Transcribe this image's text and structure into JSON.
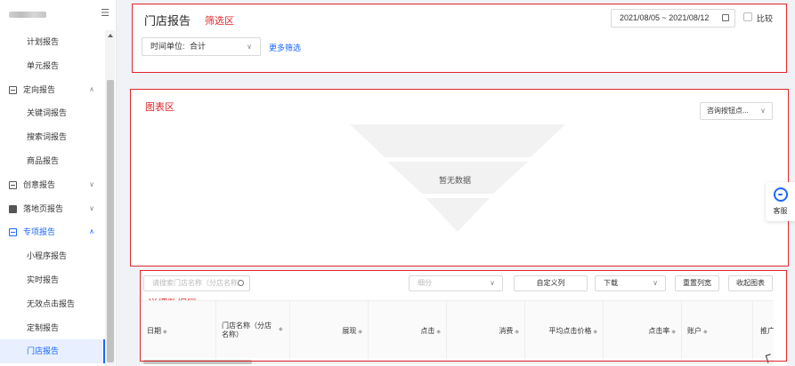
{
  "sidebar": {
    "collapse_icon": "menu-fold-icon",
    "items": [
      {
        "label": "计划报告",
        "type": "sub"
      },
      {
        "label": "单元报告",
        "type": "sub"
      },
      {
        "label": "定向报告",
        "type": "group",
        "icon": "document-icon",
        "expanded": true
      },
      {
        "label": "关键词报告",
        "type": "sub"
      },
      {
        "label": "搜索词报告",
        "type": "sub"
      },
      {
        "label": "商品报告",
        "type": "sub"
      },
      {
        "label": "创意报告",
        "type": "group",
        "icon": "document-icon",
        "expanded": false
      },
      {
        "label": "落地页报告",
        "type": "group",
        "icon": "page-icon",
        "expanded": false
      },
      {
        "label": "专项报告",
        "type": "group",
        "icon": "document-icon",
        "expanded": true,
        "highlight": true
      },
      {
        "label": "小程序报告",
        "type": "sub"
      },
      {
        "label": "实时报告",
        "type": "sub"
      },
      {
        "label": "无效点击报告",
        "type": "sub"
      },
      {
        "label": "定制报告",
        "type": "sub"
      },
      {
        "label": "门店报告",
        "type": "sub",
        "active": true
      }
    ]
  },
  "filter": {
    "title": "门店报告",
    "annotation": "筛选区",
    "date_range": "2021/08/05 ~ 2021/08/12",
    "compare_label": "比较",
    "unit_label": "时间单位:",
    "unit_value": "合计",
    "more_filter": "更多筛选"
  },
  "chart": {
    "annotation": "图表区",
    "dimension_select": "咨询按钮点...",
    "empty_text": "暂无数据"
  },
  "service": {
    "label": "客服"
  },
  "detail": {
    "annotation": "详细数据区",
    "search_placeholder": "请搜索门店名称（分店名称）",
    "breakdown_placeholder": "细分",
    "custom_columns": "自定义列",
    "download": "下载",
    "reset_width": "重置列宽",
    "collapse_chart": "收起图表",
    "columns": [
      "日期",
      "门店名称（分店名称）",
      "展现",
      "点击",
      "消费",
      "平均点击价格",
      "点击率",
      "账户",
      "推广"
    ]
  },
  "colors": {
    "accent": "#1a66ff",
    "annotation": "#e0262a"
  }
}
